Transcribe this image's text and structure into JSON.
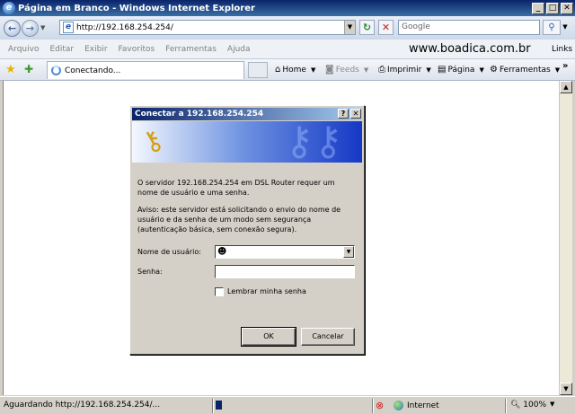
{
  "window": {
    "title": "Página em Branco - Windows Internet Explorer",
    "minimize": "_",
    "maximize": "□",
    "close": "✕"
  },
  "address_bar": {
    "url": "http://192.168.254.254/",
    "refresh_symbol": "↻",
    "stop_symbol": "✕",
    "search_placeholder": "Google"
  },
  "menu": {
    "items": [
      "Arquivo",
      "Editar",
      "Exibir",
      "Favoritos",
      "Ferramentas",
      "Ajuda"
    ],
    "brand": "www.boadica.com.br",
    "links": "Links"
  },
  "tabs": {
    "active_label": "Conectando..."
  },
  "command_bar": {
    "home": "Home",
    "feeds": "Feeds",
    "print": "Imprimir",
    "page": "Página",
    "tools": "Ferramentas"
  },
  "status_bar": {
    "text": "Aguardando http://192.168.254.254/...",
    "zone": "Internet",
    "zoom": "100%",
    "progress_fraction": 0.04
  },
  "dialog": {
    "title": "Conectar a 192.168.254.254",
    "help": "?",
    "close": "✕",
    "message": "O servidor 192.168.254.254 em DSL Router requer um nome de usuário e uma senha.",
    "warning": "Aviso: este servidor está solicitando o envio do nome de usuário e da senha de um modo sem segurança (autenticação básica, sem conexão segura).",
    "username_label": "Nome de usuário:",
    "password_label": "Senha:",
    "remember_label": "Lembrar minha senha",
    "ok_label": "OK",
    "cancel_label": "Cancelar"
  },
  "colors": {
    "title_bar": "#0a246a",
    "dialog_face": "#d4d0c8",
    "banner_end": "#1538c6"
  }
}
